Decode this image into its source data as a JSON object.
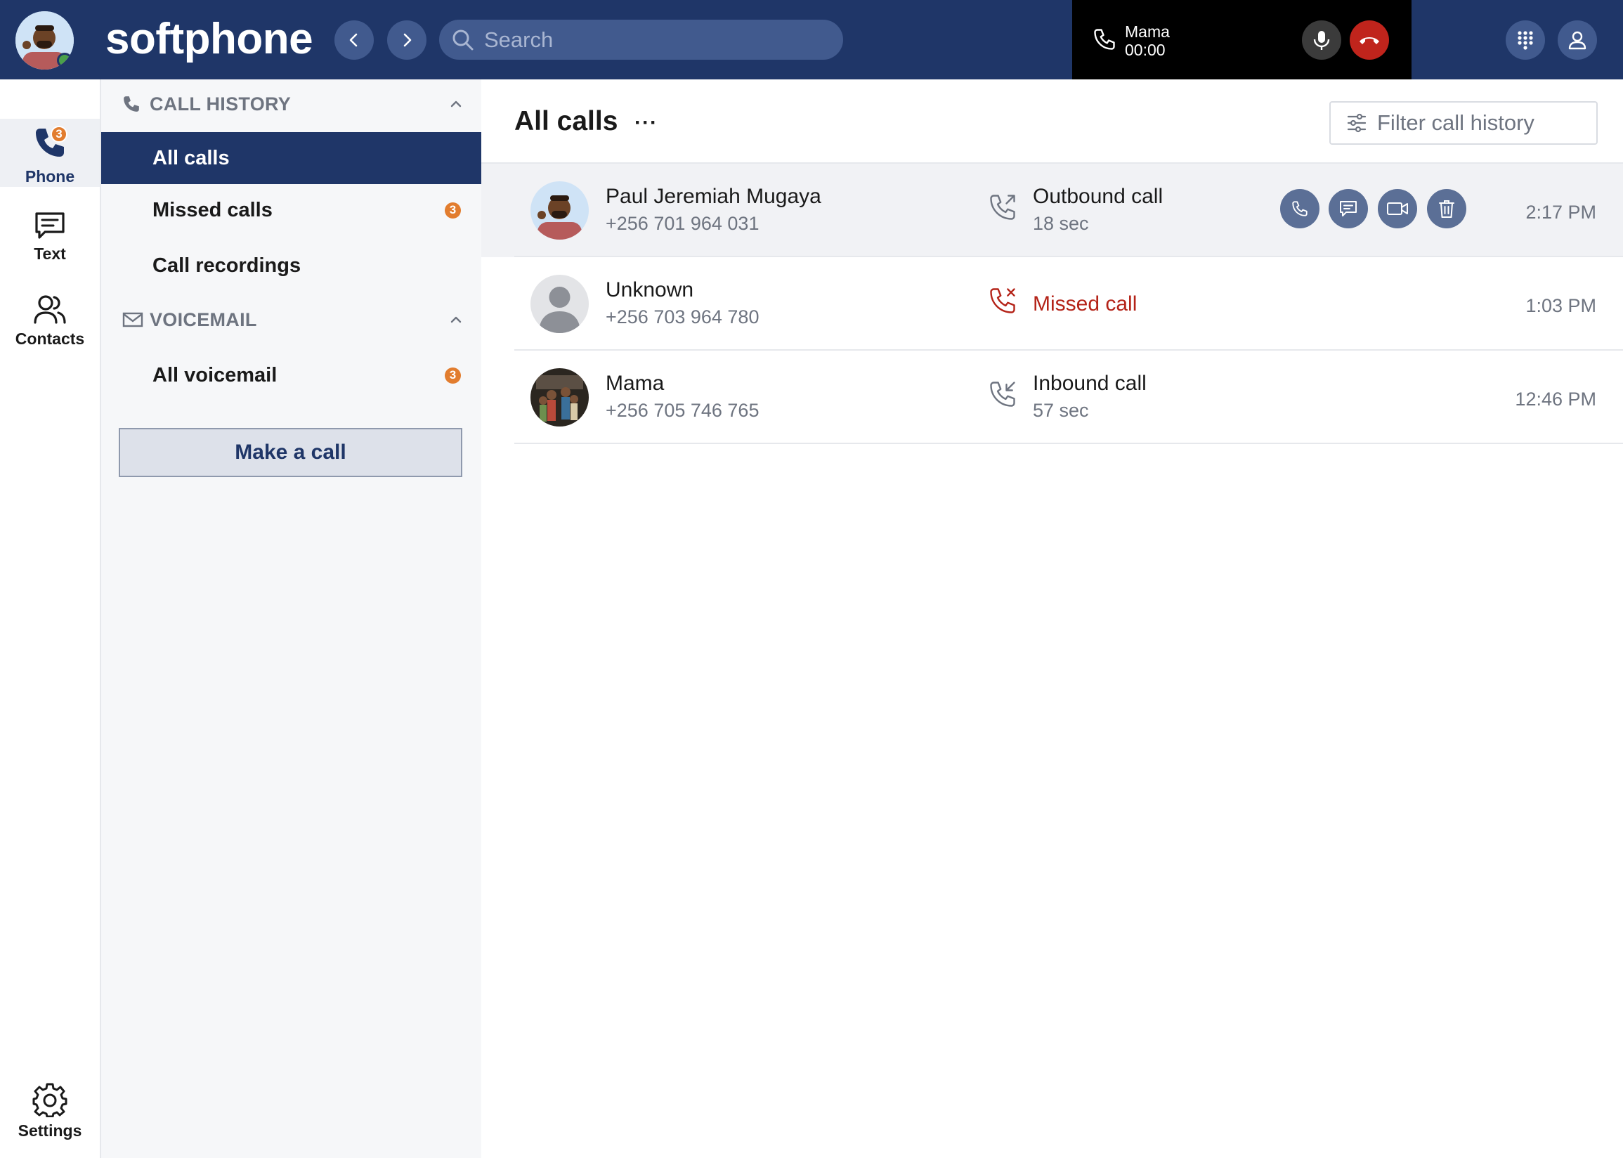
{
  "app": {
    "brand": "softphone",
    "search_placeholder": "Search"
  },
  "active_call": {
    "name": "Mama",
    "duration": "00:00"
  },
  "rail": {
    "phone_label": "Phone",
    "phone_badge": "3",
    "text_label": "Text",
    "contacts_label": "Contacts",
    "settings_label": "Settings"
  },
  "sidebar": {
    "call_history_title": "CALL HISTORY",
    "items": [
      {
        "label": "All calls",
        "badge": ""
      },
      {
        "label": "Missed calls",
        "badge": "3"
      },
      {
        "label": "Call recordings",
        "badge": ""
      }
    ],
    "voicemail_title": "VOICEMAIL",
    "voicemail_items": [
      {
        "label": "All voicemail",
        "badge": "3"
      }
    ],
    "make_call": "Make a call"
  },
  "main": {
    "title": "All calls",
    "more": "···",
    "filter_placeholder": "Filter call history"
  },
  "calls": [
    {
      "name": "Paul Jeremiah Mugaya",
      "number": "+256 701 964 031",
      "type": "Outbound call",
      "duration": "18 sec",
      "time": "2:17 PM",
      "icon": "outbound-call-icon"
    },
    {
      "name": "Unknown",
      "number": "+256 703 964 780",
      "type": "Missed call",
      "duration": "",
      "time": "1:03 PM",
      "icon": "missed-call-icon"
    },
    {
      "name": "Mama",
      "number": "+256 705 746 765",
      "type": "Inbound call",
      "duration": "57 sec",
      "time": "12:46 PM",
      "icon": "inbound-call-icon"
    }
  ],
  "colors": {
    "header": "#1f3668",
    "accent_badge": "#e27d2f",
    "missed": "#b42318",
    "hangup": "#c0241c"
  }
}
